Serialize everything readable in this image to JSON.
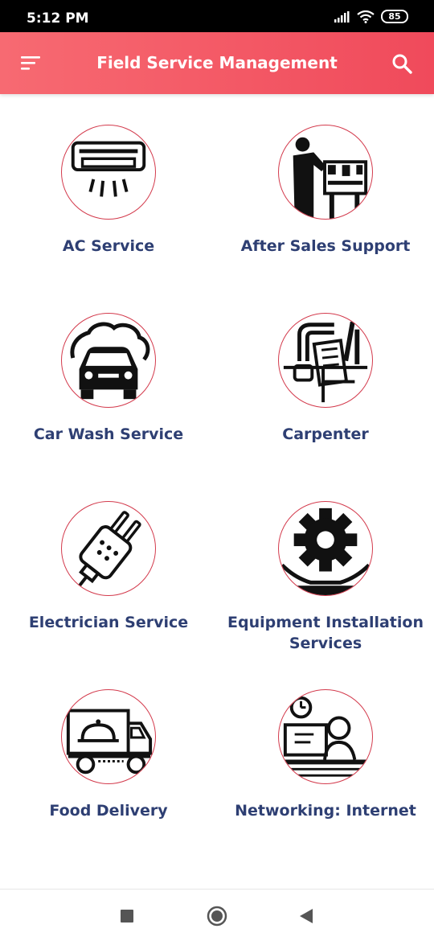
{
  "status_bar": {
    "time": "5:12 PM",
    "battery": "85",
    "icons": [
      "signal-icon",
      "wifi-icon",
      "battery-icon"
    ]
  },
  "app_bar": {
    "title": "Field Service Management",
    "menu_icon": "menu-icon",
    "search_icon": "search-icon"
  },
  "colors": {
    "accent_start": "#f76a72",
    "accent_end": "#f04a5b",
    "label": "#2e3f73",
    "circle_border": "#d33a4c"
  },
  "services": [
    {
      "label": "AC Service",
      "icon": "air-conditioner-icon"
    },
    {
      "label": "After Sales Support",
      "icon": "support-person-icon"
    },
    {
      "label": "Car Wash Service",
      "icon": "car-wash-icon"
    },
    {
      "label": "Carpenter",
      "icon": "carpenter-tools-icon"
    },
    {
      "label": "Electrician Service",
      "icon": "electric-plug-icon"
    },
    {
      "label": "Equipment Installation Services",
      "icon": "gear-icon"
    },
    {
      "label": "Food Delivery",
      "icon": "delivery-truck-icon"
    },
    {
      "label": "Networking: Internet",
      "icon": "network-engineer-icon"
    }
  ],
  "nav_bar": {
    "icons": [
      "recent-apps-icon",
      "home-icon",
      "back-icon"
    ]
  }
}
